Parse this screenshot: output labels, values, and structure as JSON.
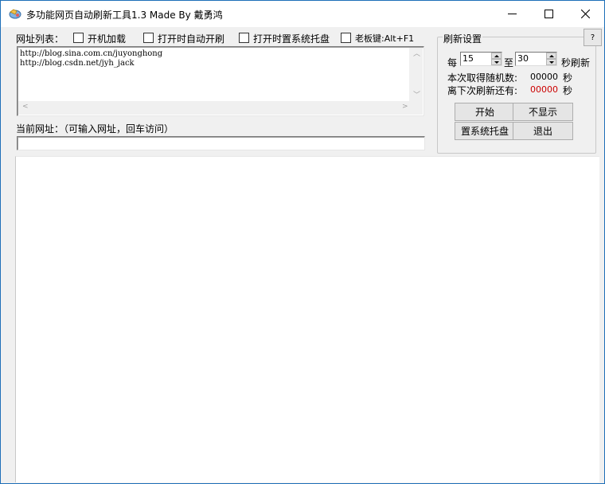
{
  "window": {
    "title": "多功能网页自动刷新工具1.3 Made By 戴勇鸿",
    "app_icon": "app-icon",
    "controls": {
      "minimize": "minimize-icon",
      "maximize": "maximize-icon",
      "close": "close-icon"
    }
  },
  "url_list": {
    "label": "网址列表：",
    "urls": [
      "http://blog.sina.com.cn/juyonghong",
      "http://blog.csdn.net/jyh_jack"
    ]
  },
  "options": [
    {
      "label": "开机加载",
      "checked": false
    },
    {
      "label": "打开时自动开刷",
      "checked": false
    },
    {
      "label": "打开时置系统托盘",
      "checked": false
    },
    {
      "label": "老板键:Alt+F1",
      "checked": false
    }
  ],
  "current_url": {
    "label": "当前网址：（可输入网址，回车访问）",
    "value": ""
  },
  "refresh": {
    "group_title": "刷新设置",
    "help_label": "?",
    "every_label": "每",
    "min_value": "15",
    "to_label": "至",
    "max_value": "30",
    "seconds_refresh_label": "秒刷新",
    "random_label": "本次取得随机数:",
    "random_value": "00000",
    "random_unit": "秒",
    "remaining_label": "离下次刷新还有:",
    "remaining_value": "00000",
    "remaining_unit": "秒",
    "remaining_color": "#cc0000"
  },
  "buttons": {
    "start": "开始",
    "hide": "不显示",
    "tray": "置系统托盘",
    "exit": "退出"
  }
}
